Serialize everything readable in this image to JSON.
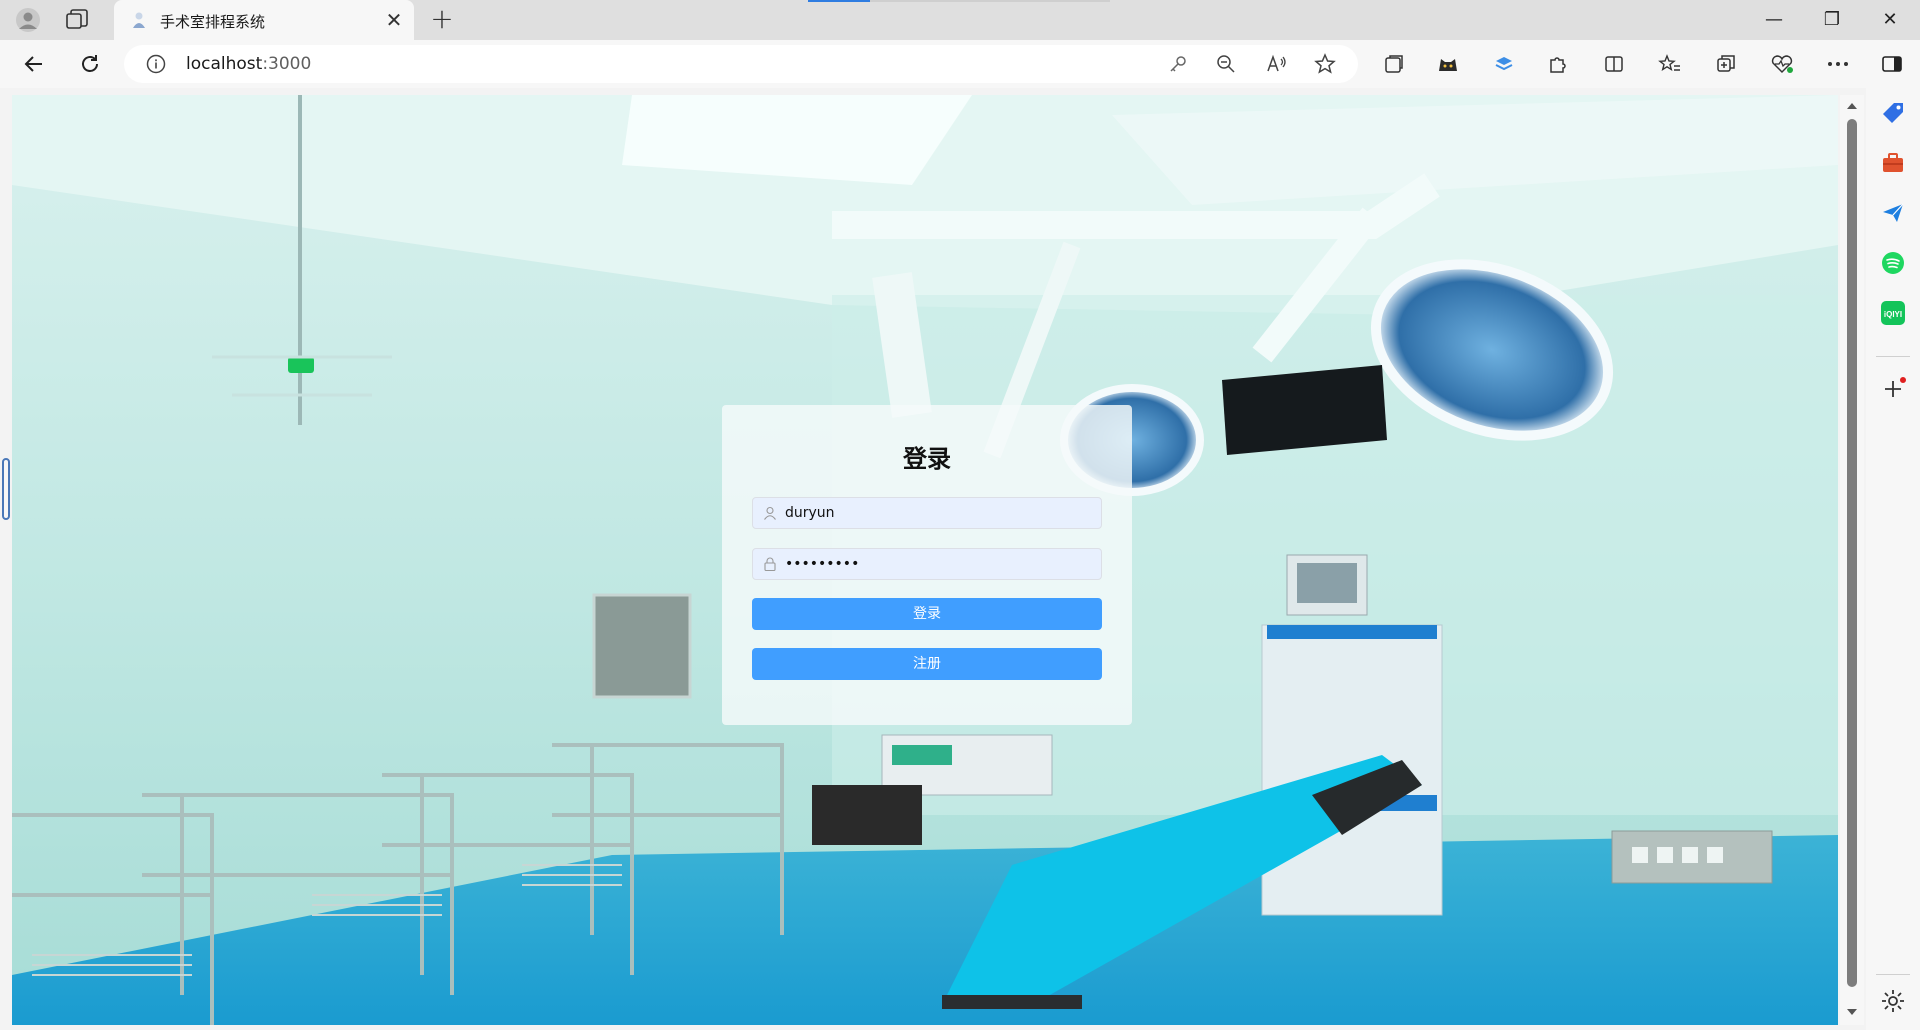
{
  "browser": {
    "tab": {
      "title": "手术室排程系统",
      "close": "✕"
    },
    "new_tab": "+",
    "window": {
      "minimize": "—",
      "restore": "❐",
      "close": "✕"
    },
    "address": {
      "host": "localhost",
      "port": ":3000"
    }
  },
  "login": {
    "title": "登录",
    "username": "duryun",
    "password": "•••••••••",
    "login_button": "登录",
    "register_button": "注册"
  },
  "colors": {
    "primary_button": "#409eff",
    "input_background": "#e8f0fe"
  },
  "sidebar_icons": [
    "tag-icon",
    "briefcase-icon",
    "send-icon",
    "spotify-icon",
    "iqiyi-icon",
    "add-icon",
    "settings-icon"
  ],
  "sidebar_labels": {
    "iqiyi": "iQIYI"
  }
}
